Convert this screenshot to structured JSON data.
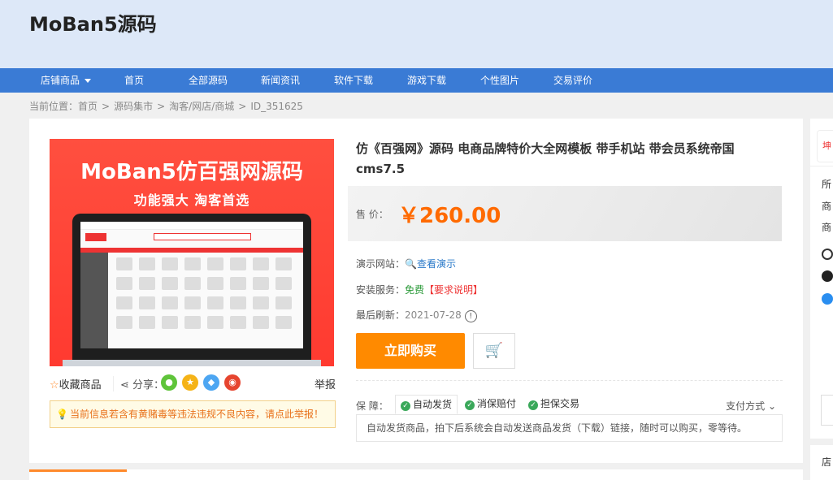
{
  "site": {
    "title": "MoBan5源码"
  },
  "nav": {
    "items": [
      {
        "label": "店铺商品"
      },
      {
        "label": "首页"
      },
      {
        "label": "全部源码"
      },
      {
        "label": "新闻资讯"
      },
      {
        "label": "软件下载"
      },
      {
        "label": "游戏下载"
      },
      {
        "label": "个性图片"
      },
      {
        "label": "交易评价"
      }
    ]
  },
  "breadcrumb": {
    "prefix": "当前位置：",
    "items": [
      "首页",
      "源码集市",
      "淘客/网店/商城",
      "ID_351625"
    ],
    "sep": ">"
  },
  "product_image": {
    "title": "MoBan5仿百强网源码",
    "subtitle": "功能强大 淘客首选"
  },
  "actions": {
    "favorite": "收藏商品",
    "share": "分享：",
    "report": "举报"
  },
  "notice": {
    "text": "当前信息若含有黄赌毒等违法违规不良内容，请点此举报！"
  },
  "product": {
    "title": "仿《百强网》源码 电商品牌特价大全网模板 带手机站 带会员系统帝国cms7.5",
    "price_label": "售  价：",
    "price": "￥260.00",
    "demo_label": "演示网站：",
    "demo_link": "查看演示",
    "install_label": "安装服务：",
    "install_value": "免费",
    "install_note": "【要求说明】",
    "refresh_label": "最后刷新：",
    "refresh_date": "2021-07-28",
    "buy_button": "立即购买"
  },
  "guarantee": {
    "label": "保  障：",
    "tabs": [
      "自动发货",
      "消保赔付",
      "担保交易"
    ],
    "payment": "支付方式",
    "description": "自动发货商品，拍下后系统会自动发送商品发货（下载）链接，随时可以购买，零等待。"
  },
  "side_panel": {
    "lines": [
      "所",
      "商",
      "商"
    ],
    "bottom": "店"
  },
  "colors": {
    "nav_bg": "#3a7bd5",
    "accent": "#ff8a00",
    "price": "#ff6a00",
    "header_bg": "#dde8f8"
  }
}
